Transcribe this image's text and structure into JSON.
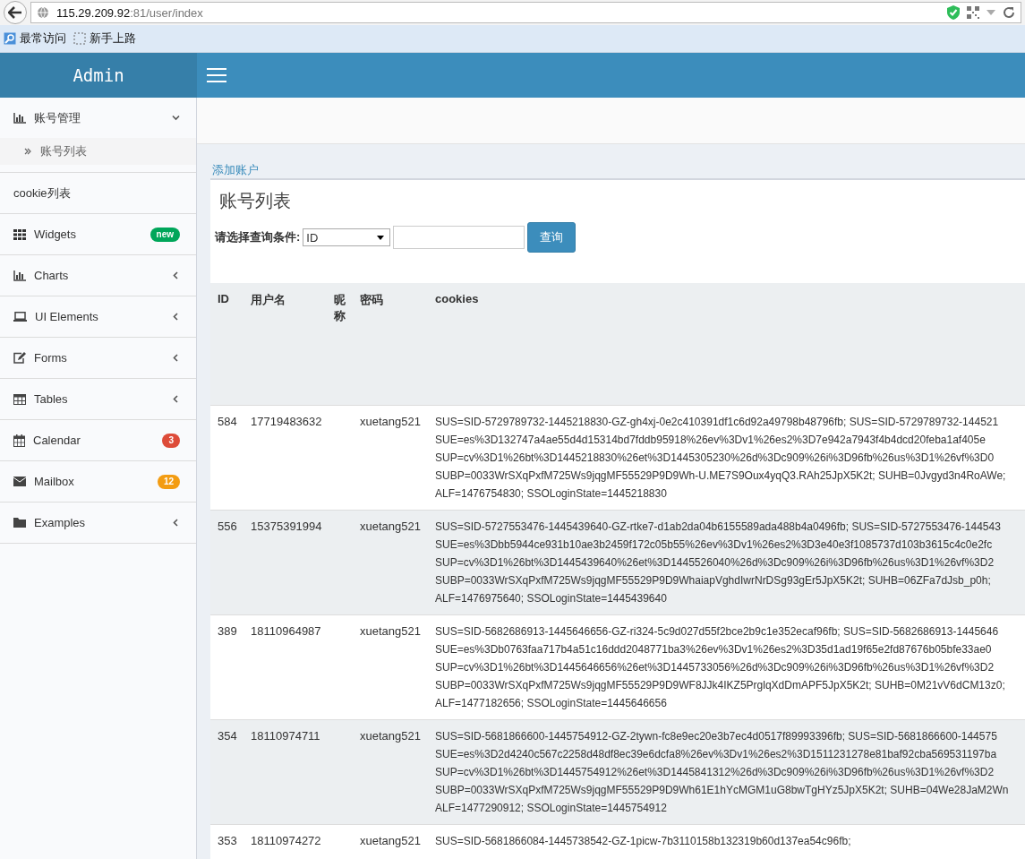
{
  "browser": {
    "url_host": "115.29.209.92",
    "url_path": ":81/user/index",
    "bookmarks": [
      {
        "label": "最常访问"
      },
      {
        "label": "新手上路"
      }
    ]
  },
  "header": {
    "logo": "Admin"
  },
  "sidebar": {
    "items": [
      {
        "label": "账号管理",
        "kind": "menu",
        "expanded": true,
        "children": [
          {
            "label": "账号列表"
          }
        ]
      },
      {
        "label": "cookie列表",
        "kind": "link"
      },
      {
        "label": "Widgets",
        "kind": "badge",
        "badge": {
          "text": "new",
          "color": "#00a65a"
        }
      },
      {
        "label": "Charts",
        "kind": "menu",
        "expanded": false
      },
      {
        "label": "UI Elements",
        "kind": "menu",
        "expanded": false
      },
      {
        "label": "Forms",
        "kind": "menu",
        "expanded": false
      },
      {
        "label": "Tables",
        "kind": "menu",
        "expanded": false
      },
      {
        "label": "Calendar",
        "kind": "badge",
        "badge": {
          "text": "3",
          "color": "#dd4b39"
        }
      },
      {
        "label": "Mailbox",
        "kind": "badge",
        "badge": {
          "text": "12",
          "color": "#f39c12"
        }
      },
      {
        "label": "Examples",
        "kind": "menu",
        "expanded": false
      }
    ]
  },
  "content": {
    "add_link": "添加账户",
    "box_title": "账号列表",
    "filter": {
      "label": "请选择查询条件:",
      "select_value": "ID",
      "search_button": "查询"
    },
    "table": {
      "columns": [
        "ID",
        "用户名",
        "昵称",
        "密码",
        "cookies"
      ],
      "rows": [
        {
          "id": "584",
          "username": "17719483632",
          "password": "xuetang521",
          "cookies": [
            "SUS=SID-5729789732-1445218830-GZ-gh4xj-0e2c410391df1c6d92a49798b48796fb; SUS=SID-5729789732-144521",
            "SUE=es%3D132747a4ae55d4d15314bd7fddb95918%26ev%3Dv1%26es2%3D7e942a7943f4b4dcd20feba1af405e",
            "SUP=cv%3D1%26bt%3D1445218830%26et%3D1445305230%26d%3Dc909%26i%3D96fb%26us%3D1%26vf%3D0",
            "SUBP=0033WrSXqPxfM725Ws9jqgMF55529P9D9Wh-U.ME7S9Oux4yqQ3.RAh25JpX5K2t; SUHB=0Jvgyd3n4RoAWe;",
            "ALF=1476754830; SSOLoginState=1445218830"
          ]
        },
        {
          "id": "556",
          "username": "15375391994",
          "password": "xuetang521",
          "cookies": [
            "SUS=SID-5727553476-1445439640-GZ-rtke7-d1ab2da04b6155589ada488b4a0496fb; SUS=SID-5727553476-144543",
            "SUE=es%3Dbb5944ce931b10ae3b2459f172c05b55%26ev%3Dv1%26es2%3D3e40e3f1085737d103b3615c4c0e2fc",
            "SUP=cv%3D1%26bt%3D1445439640%26et%3D1445526040%26d%3Dc909%26i%3D96fb%26us%3D1%26vf%3D2",
            "SUBP=0033WrSXqPxfM725Ws9jqgMF55529P9D9WhaiapVghdIwrNrDSg93gEr5JpX5K2t; SUHB=06ZFa7dJsb_p0h;",
            "ALF=1476975640; SSOLoginState=1445439640"
          ]
        },
        {
          "id": "389",
          "username": "18110964987",
          "password": "xuetang521",
          "cookies": [
            "SUS=SID-5682686913-1445646656-GZ-ri324-5c9d027d55f2bce2b9c1e352ecaf96fb; SUS=SID-5682686913-1445646",
            "SUE=es%3Db0763faa717b4a51c16ddd2048771ba3%26ev%3Dv1%26es2%3D35d1ad19f65e2fd87676b05bfe33ae0",
            "SUP=cv%3D1%26bt%3D1445646656%26et%3D1445733056%26d%3Dc909%26i%3D96fb%26us%3D1%26vf%3D2",
            "SUBP=0033WrSXqPxfM725Ws9jqgMF55529P9D9WF8JJk4IKZ5PrglqXdDmAPF5JpX5K2t; SUHB=0M21vV6dCM13z0;",
            "ALF=1477182656; SSOLoginState=1445646656"
          ]
        },
        {
          "id": "354",
          "username": "18110974711",
          "password": "xuetang521",
          "cookies": [
            "SUS=SID-5681866600-1445754912-GZ-2tywn-fc8e9ec20e3b7ec4d0517f89993396fb; SUS=SID-5681866600-144575",
            "SUE=es%3D2d4240c567c2258d48df8ec39e6dcfa8%26ev%3Dv1%26es2%3D1511231278e81baf92cba569531197ba",
            "SUP=cv%3D1%26bt%3D1445754912%26et%3D1445841312%26d%3Dc909%26i%3D96fb%26us%3D1%26vf%3D2",
            "SUBP=0033WrSXqPxfM725Ws9jqgMF55529P9D9Wh61E1hYcMGM1uG8bwTgHYz5JpX5K2t; SUHB=04We28JaM2Wn",
            "ALF=1477290912; SSOLoginState=1445754912"
          ]
        },
        {
          "id": "353",
          "username": "18110974272",
          "password": "xuetang521",
          "cookies": [
            "SUS=SID-5681866084-1445738542-GZ-1picw-7b3110158b132319b60d137ea54c96fb;"
          ]
        }
      ]
    }
  }
}
